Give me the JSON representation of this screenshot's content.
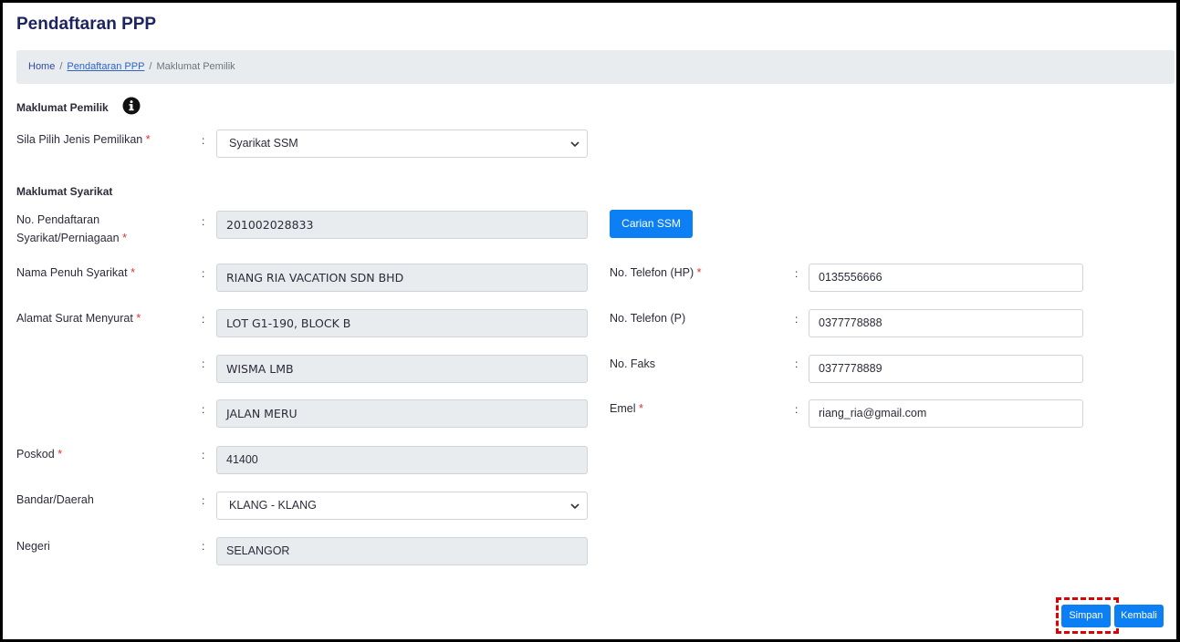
{
  "page": {
    "title": "Pendaftaran PPP"
  },
  "breadcrumb": {
    "home": "Home",
    "link": "Pendaftaran PPP",
    "current": "Maklumat Pemilik",
    "separator": "/"
  },
  "owner_section": {
    "title": "Maklumat Pemilik",
    "ownership_label": "Sila Pilih Jenis Pemilikan",
    "ownership_value": "Syarikat SSM"
  },
  "company_section": {
    "title": "Maklumat Syarikat",
    "reg_no_label_1": "No. Pendaftaran",
    "reg_no_label_2": "Syarikat/Perniagaan",
    "reg_no_value": "201002028833",
    "search_button": "Carian SSM",
    "name_label": "Nama Penuh Syarikat",
    "name_value": "RIANG RIA VACATION SDN BHD",
    "address_label": "Alamat Surat Menyurat",
    "address_1": "LOT G1-190, BLOCK B",
    "address_2": "WISMA LMB",
    "address_3": "JALAN MERU",
    "postcode_label": "Poskod",
    "postcode_value": "41400",
    "city_label": "Bandar/Daerah",
    "city_value": "KLANG - KLANG",
    "state_label": "Negeri",
    "state_value": "SELANGOR",
    "phone_hp_label": "No. Telefon (HP)",
    "phone_hp_value": "0135556666",
    "phone_p_label": "No. Telefon (P)",
    "phone_p_value": "0377778888",
    "fax_label": "No. Faks",
    "fax_value": "0377778889",
    "email_label": "Emel",
    "email_value": "riang_ria@gmail.com"
  },
  "common": {
    "colon": ":",
    "required_mark": "*"
  },
  "actions": {
    "save": "Simpan",
    "back": "Kembali"
  },
  "colors": {
    "primary": "#0d7ff5",
    "title": "#1d2461",
    "highlight": "#e00000"
  },
  "icons": {
    "info": "info-circle-icon",
    "chevron": "chevron-down-icon"
  }
}
